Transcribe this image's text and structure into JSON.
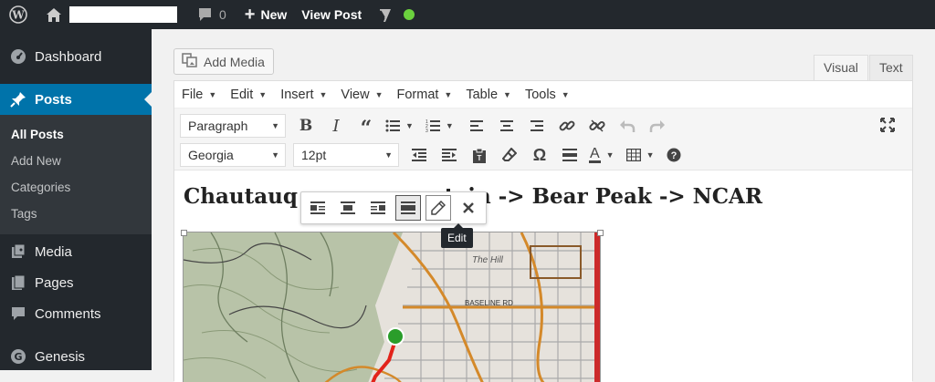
{
  "adminbar": {
    "comments_count": "0",
    "new_label": "New",
    "view_post_label": "View Post",
    "status_color": "#6bd13e"
  },
  "sidebar": {
    "items": [
      {
        "label": "Dashboard",
        "icon": "dashboard-icon"
      },
      {
        "label": "Posts",
        "icon": "pin-icon",
        "current": true
      },
      {
        "label": "Media",
        "icon": "media-icon"
      },
      {
        "label": "Pages",
        "icon": "pages-icon"
      },
      {
        "label": "Comments",
        "icon": "comments-icon"
      },
      {
        "label": "Genesis",
        "icon": "genesis-icon"
      }
    ],
    "submenu": [
      "All Posts",
      "Add New",
      "Categories",
      "Tags"
    ],
    "accent": "#0073aa"
  },
  "editor": {
    "add_media_label": "Add Media",
    "tabs": {
      "visual": "Visual",
      "text": "Text"
    },
    "menus": [
      "File",
      "Edit",
      "Insert",
      "View",
      "Format",
      "Table",
      "Tools"
    ],
    "format_select": "Paragraph",
    "font_family_select": "Georgia",
    "font_size_select": "12pt",
    "heading_visible": {
      "left": "Chautauq",
      "mid": "M",
      "right": "ountain -> Bear Peak -> NCAR"
    },
    "image_toolbar_tooltip": "Edit",
    "map_labels": {
      "the_hill": "The Hill",
      "baseline": "BASELINE RD"
    }
  }
}
